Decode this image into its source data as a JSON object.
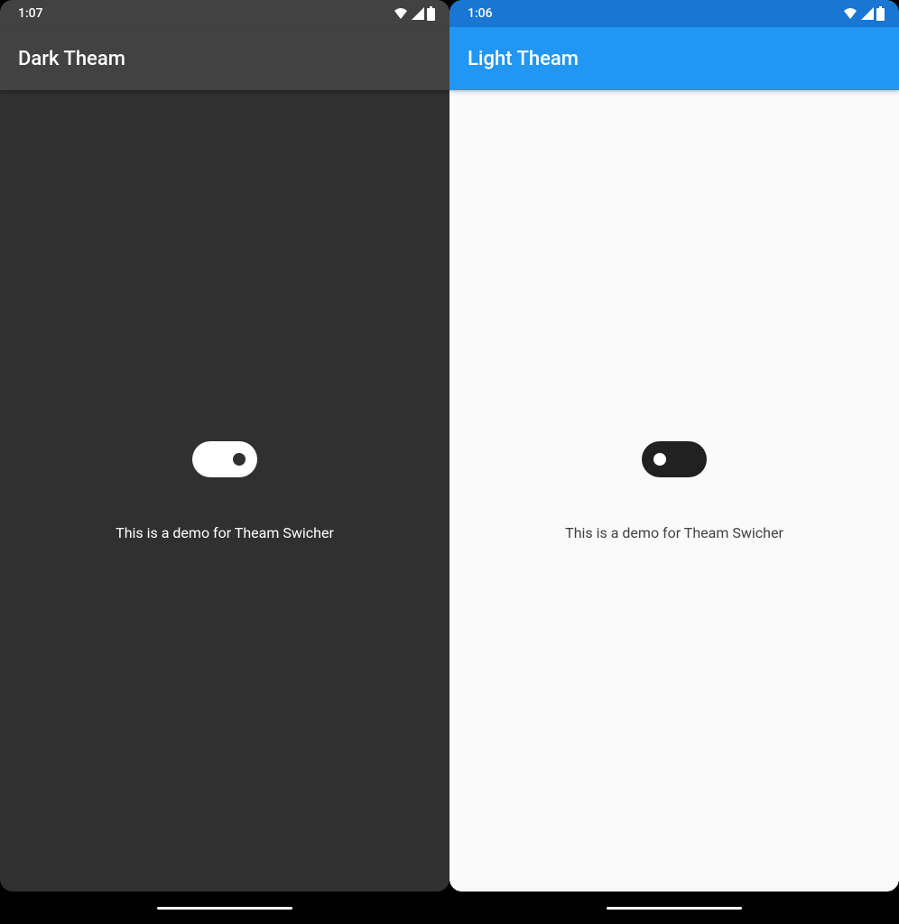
{
  "dark": {
    "status_time": "1:07",
    "app_bar_title": "Dark Theam",
    "demo_text": "This is a demo for Theam Swicher",
    "switch_on": true
  },
  "light": {
    "status_time": "1:06",
    "app_bar_title": "Light Theam",
    "demo_text": "This is a demo for Theam Swicher",
    "switch_on": false
  },
  "colors": {
    "dark_bg": "#303030",
    "dark_appbar": "#424242",
    "light_bg": "#fafafa",
    "light_statusbar": "#1976d2",
    "light_appbar": "#2196f3"
  }
}
